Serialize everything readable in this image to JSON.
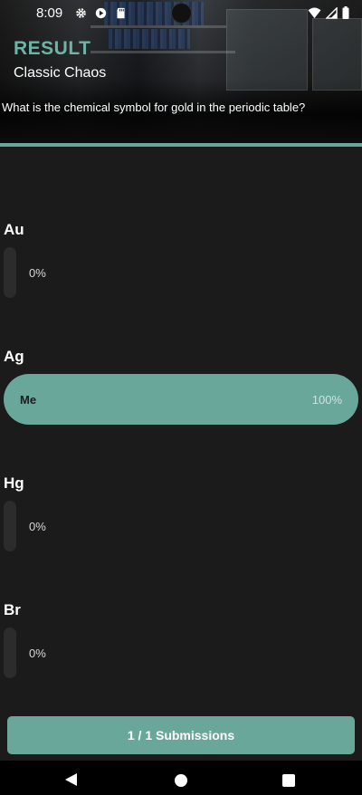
{
  "status_bar": {
    "time": "8:09",
    "icons_left": [
      "gear-icon",
      "play-icon",
      "sd-card-icon"
    ],
    "icons_right": [
      "wifi-icon",
      "cell-signal-icon",
      "battery-icon"
    ]
  },
  "header": {
    "title": "RESULT",
    "subtitle": "Classic Chaos",
    "question": "What is the chemical symbol for gold in the periodic table?"
  },
  "options": [
    {
      "label": "Au",
      "percent_text": "0%",
      "percent": 0,
      "voter": "",
      "selected": false
    },
    {
      "label": "Ag",
      "percent_text": "100%",
      "percent": 100,
      "voter": "Me",
      "selected": true
    },
    {
      "label": "Hg",
      "percent_text": "0%",
      "percent": 0,
      "voter": "",
      "selected": false
    },
    {
      "label": "Br",
      "percent_text": "0%",
      "percent": 0,
      "voter": "",
      "selected": false
    }
  ],
  "footer": {
    "submissions_label": "1 / 1 Submissions"
  },
  "colors": {
    "accent": "#6aa79b",
    "title": "#6fb3a6",
    "background": "#1b1b1b",
    "empty_bar": "#2c2c2c"
  }
}
